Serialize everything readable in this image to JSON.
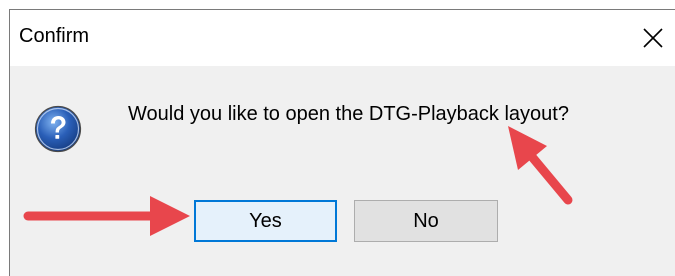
{
  "dialog": {
    "title": "Confirm",
    "message": "Would you like to open the DTG-Playback layout?",
    "icon": "question-icon",
    "buttons": {
      "yes_label": "Yes",
      "no_label": "No"
    },
    "close_icon": "close-icon"
  },
  "colors": {
    "default_button_border": "#0078d7",
    "annotation_arrow": "#e8464c",
    "dialog_background": "#f0f0f0"
  }
}
